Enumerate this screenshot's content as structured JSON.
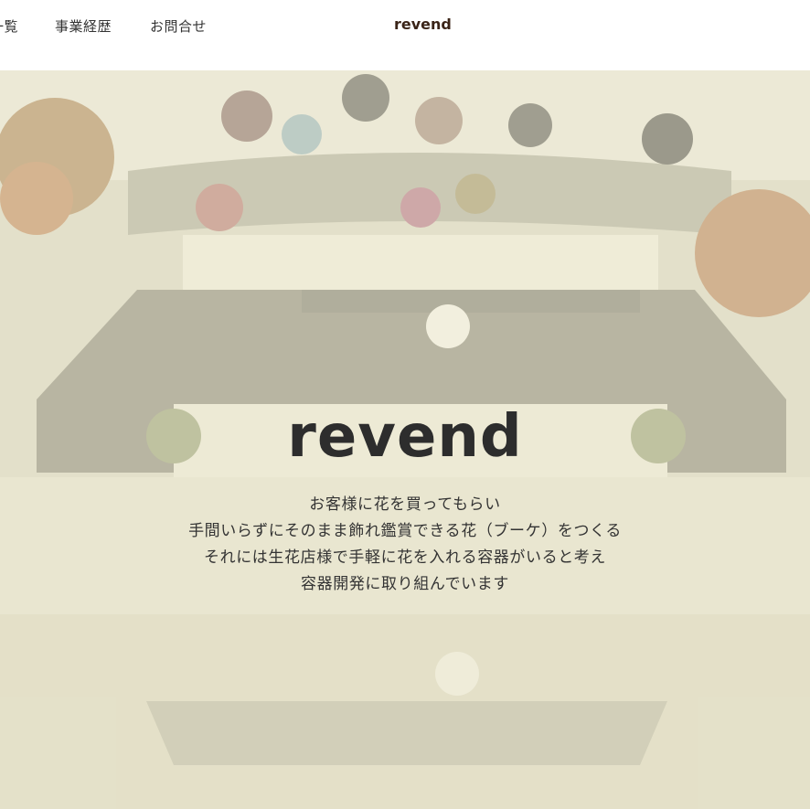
{
  "header": {
    "nav": [
      "商品一覧",
      "事業経歴",
      "お問合せ"
    ],
    "brand": "revend"
  },
  "hero": {
    "title": "revend",
    "lines": [
      "お客様に花を買ってもらい",
      "手間いらずにそのまま飾れ鑑賞できる花（ブーケ）をつくる",
      "それには生花店様で手軽に花を入れる容器がいると考え",
      "容器開発に取り組んでいます"
    ]
  },
  "colors": {
    "brand": "#3a2418",
    "overlay": "#f4f1d7",
    "text": "#333333"
  }
}
